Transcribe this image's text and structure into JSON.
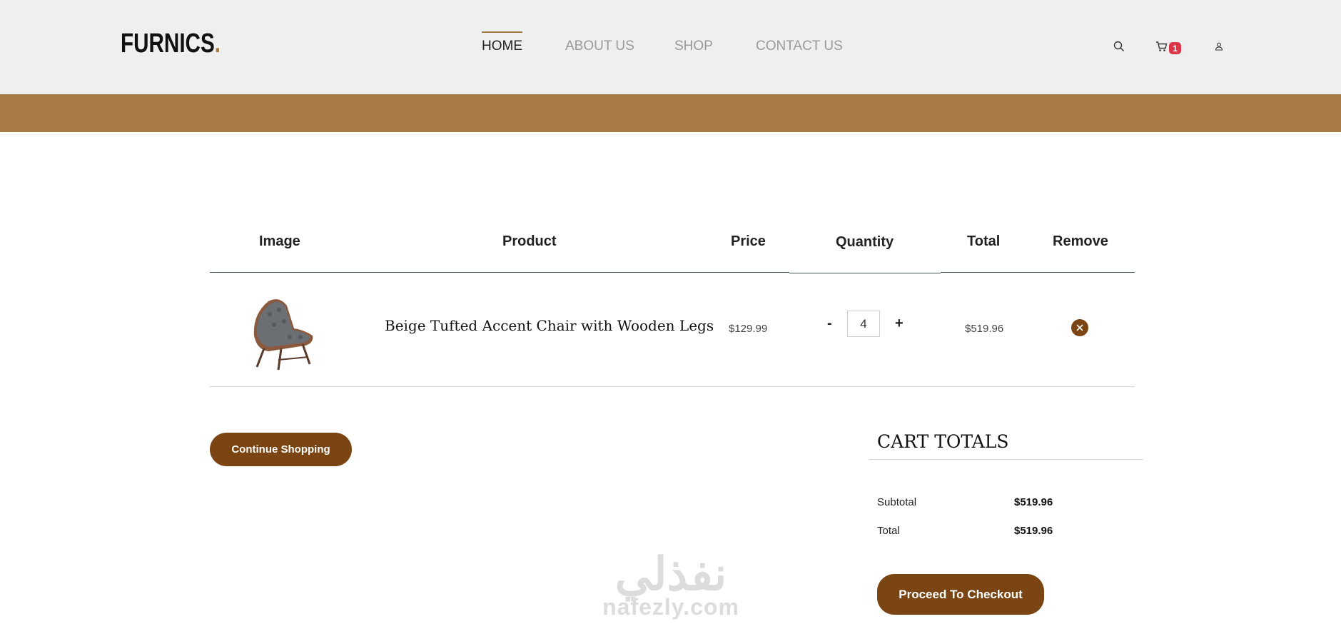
{
  "header": {
    "logo_text": "FURNICS",
    "logo_dot": ".",
    "nav": [
      {
        "label": "HOME",
        "active": true
      },
      {
        "label": "ABOUT US",
        "active": false
      },
      {
        "label": "SHOP",
        "active": false
      },
      {
        "label": "CONTACT US",
        "active": false
      }
    ],
    "icons": [
      "search-icon",
      "cart-icon",
      "user-icon"
    ],
    "cart_count": "1"
  },
  "colors": {
    "accent": "#a87a43",
    "button": "#7a4512",
    "badge": "#dc3545",
    "header_bg": "#efefef"
  },
  "cart_table": {
    "headers": {
      "image": "Image",
      "product": "Product",
      "price": "Price",
      "quantity": "Quantity",
      "total": "Total",
      "remove": "Remove"
    },
    "rows": [
      {
        "product": "Beige Tufted Accent Chair with Wooden Legs",
        "price": "$129.99",
        "quantity": "4",
        "minus": "-",
        "plus": "+",
        "total": "$519.96"
      }
    ]
  },
  "actions": {
    "continue_shopping": "Continue Shopping",
    "proceed_checkout": "Proceed To Checkout"
  },
  "cart_totals": {
    "title": "CART TOTALS",
    "subtotal_label": "Subtotal",
    "subtotal_value": "$519.96",
    "total_label": "Total",
    "total_value": "$519.96"
  },
  "watermark": {
    "arabic": "نفذلي",
    "latin": "nafezly.com"
  }
}
